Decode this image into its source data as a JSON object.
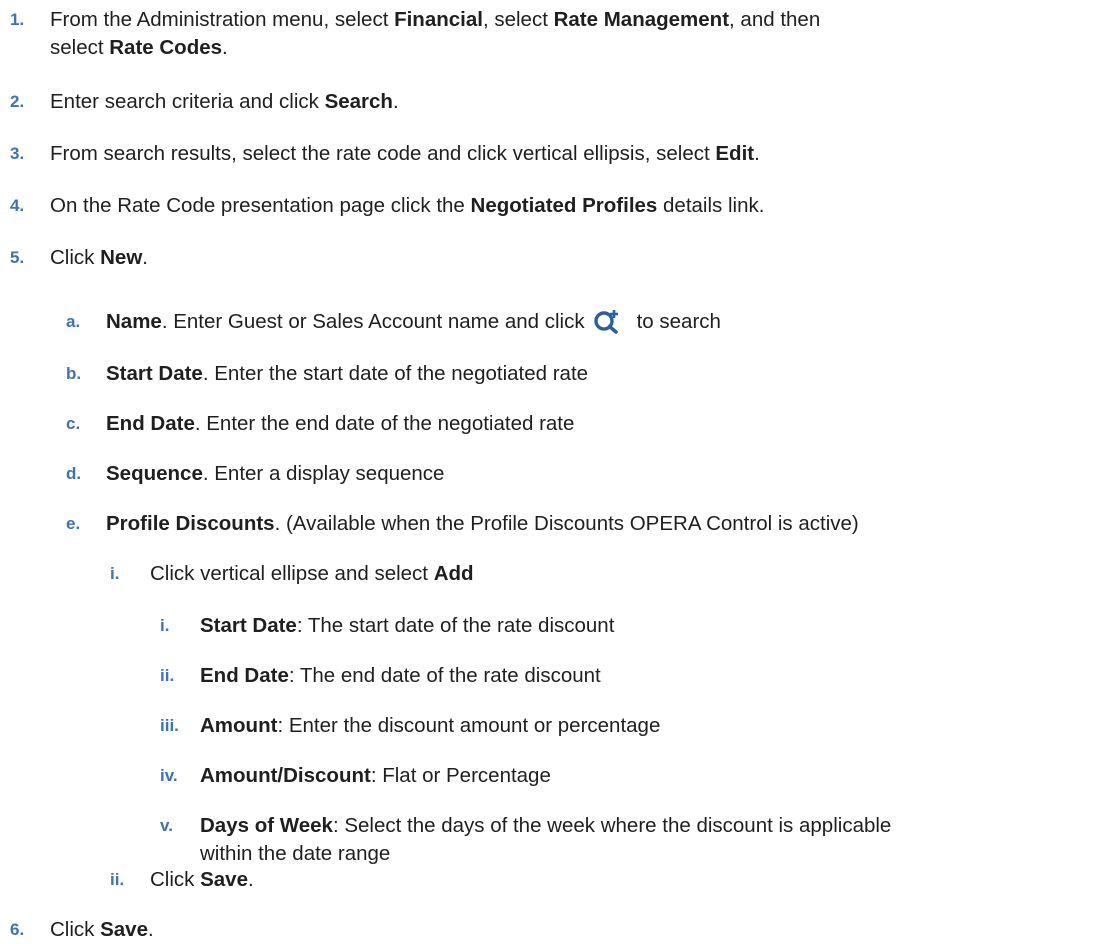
{
  "steps": {
    "s1": {
      "num": "1.",
      "t1": "From the Administration menu, select ",
      "b1": "Financial",
      "t2": ", select ",
      "b2": "Rate Management",
      "t3": ", and then",
      "t4": "select ",
      "b3": "Rate Codes",
      "t5": "."
    },
    "s2": {
      "num": "2.",
      "t1": "Enter search criteria and click ",
      "b1": "Search",
      "t2": "."
    },
    "s3": {
      "num": "3.",
      "t1": "From search results, select the rate code and click vertical ellipsis, select ",
      "b1": "Edit",
      "t2": "."
    },
    "s4": {
      "num": "4.",
      "t1": "On the Rate Code presentation page click the ",
      "b1": "Negotiated Profiles",
      "t2": " details link."
    },
    "s5": {
      "num": "5.",
      "t1": "Click ",
      "b1": "New",
      "t2": "."
    },
    "s5a": {
      "num": "a.",
      "b1": "Name",
      "t1": ". Enter Guest or Sales Account name and click",
      "t2": "to search",
      "icon": "search-add-icon"
    },
    "s5b": {
      "num": "b.",
      "b1": "Start Date",
      "t1": ". Enter the start date of the negotiated rate"
    },
    "s5c": {
      "num": "c.",
      "b1": "End Date",
      "t1": ". Enter the end date of the negotiated rate"
    },
    "s5d": {
      "num": "d.",
      "b1": "Sequence",
      "t1": ". Enter a display sequence"
    },
    "s5e": {
      "num": "e.",
      "b1": "Profile Discounts",
      "t1": ". (Available when the Profile Discounts OPERA Control is active)"
    },
    "s5e_i": {
      "num": "i.",
      "t1": "Click vertical ellipse and select ",
      "b1": "Add"
    },
    "s5e_i_i": {
      "num": "i.",
      "b1": "Start Date",
      "t1": ": The start date of the rate discount"
    },
    "s5e_i_ii": {
      "num": "ii.",
      "b1": "End Date",
      "t1": ": The end date of the rate discount"
    },
    "s5e_i_iii": {
      "num": "iii.",
      "b1": "Amount",
      "t1": ": Enter the discount amount or percentage"
    },
    "s5e_i_iv": {
      "num": "iv.",
      "b1": "Amount/Discount",
      "t1": ": Flat or Percentage"
    },
    "s5e_i_v": {
      "num": "v.",
      "b1": "Days of Week",
      "t1": ": Select the days of the week where the discount is applicable",
      "t2": "within the date range"
    },
    "s5e_ii": {
      "num": "ii.",
      "t1": "Click ",
      "b1": "Save",
      "t2": "."
    },
    "s6": {
      "num": "6.",
      "t1": "Click ",
      "b1": "Save",
      "t2": "."
    }
  },
  "colors": {
    "number": "#3a73b8",
    "text": "#1f1f1f",
    "icon": "#2a5f9e"
  }
}
